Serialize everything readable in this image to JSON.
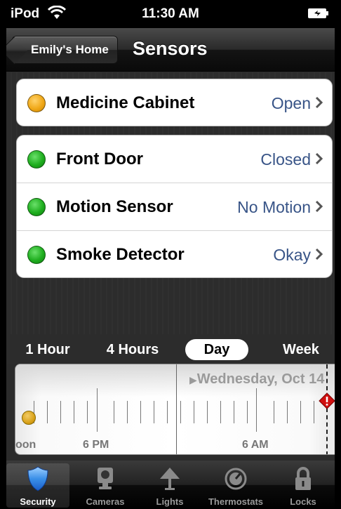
{
  "status_bar": {
    "carrier": "iPod",
    "time": "11:30 AM"
  },
  "nav": {
    "back_label": "Emily's Home",
    "title": "Sensors"
  },
  "sensor_groups": [
    [
      {
        "name": "Medicine Cabinet",
        "status": "Open",
        "indicator": "amber"
      }
    ],
    [
      {
        "name": "Front Door",
        "status": "Closed",
        "indicator": "green"
      },
      {
        "name": "Motion Sensor",
        "status": "No Motion",
        "indicator": "green"
      },
      {
        "name": "Smoke Detector",
        "status": "Okay",
        "indicator": "green"
      }
    ]
  ],
  "time_ranges": {
    "hour": "1 Hour",
    "four_hours": "4 Hours",
    "day": "Day",
    "week": "Week",
    "active": "Day"
  },
  "timeline": {
    "date": "Wednesday, Oct 14",
    "left_label": "oon",
    "mid_label": "6 PM",
    "right_label": "6 AM"
  },
  "tabs": {
    "security": "Security",
    "cameras": "Cameras",
    "lights": "Lights",
    "thermostats": "Thermostats",
    "locks": "Locks",
    "active": "Security"
  },
  "colors": {
    "accent_value": "#385487",
    "indicator_amber": "#f0a818",
    "indicator_green": "#1fae1f",
    "alert_red": "#d01010",
    "tab_active_icon": "#3a8fe8"
  }
}
